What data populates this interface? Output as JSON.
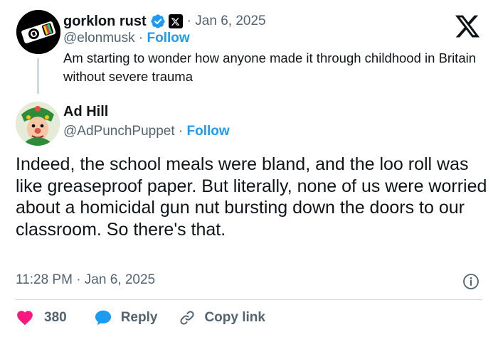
{
  "parent": {
    "name": "gorklon rust",
    "date": "· Jan 6, 2025",
    "handle": "@elonmusk",
    "separator": " · ",
    "follow_label": "Follow",
    "text": "Am starting to wonder how anyone made it through childhood in Britain without severe trauma"
  },
  "reply": {
    "name": "Ad Hill",
    "handle": "@AdPunchPuppet",
    "separator": " · ",
    "follow_label": "Follow",
    "text": "Indeed, the school meals were bland, and the loo roll was like greaseproof paper. But literally, none of us were worried about a homicidal gun nut bursting down the doors to our classroom. So there's that.",
    "timestamp": "11:28 PM · Jan 6, 2025"
  },
  "actions": {
    "like_count": "380",
    "reply_label": "Reply",
    "copy_label": "Copy link"
  },
  "colors": {
    "accent": "#1d9bf0",
    "heart": "#f91880",
    "muted": "#536471",
    "text": "#0f1419",
    "divider": "#cfd9de"
  },
  "icons": [
    "x-logo-icon",
    "verified-badge-icon",
    "x-affiliate-badge-icon",
    "info-icon",
    "heart-icon",
    "reply-icon",
    "link-icon"
  ]
}
